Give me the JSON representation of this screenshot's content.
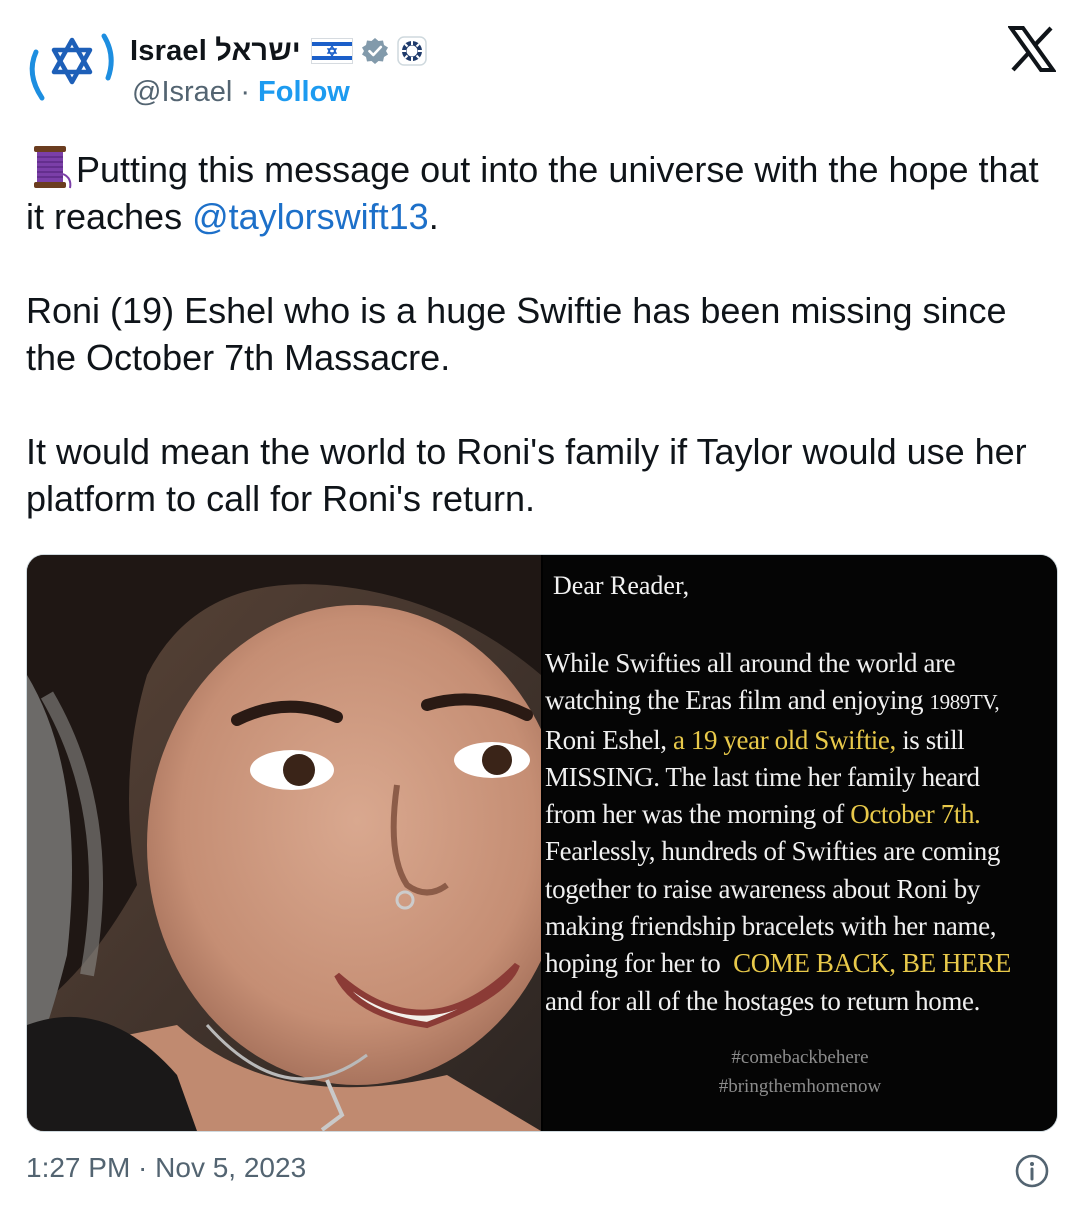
{
  "author": {
    "display_name": "Israel ישראל",
    "handle": "@Israel",
    "separator": "·",
    "follow_label": "Follow",
    "verified_color": "#829aab"
  },
  "icons": {
    "avatar": "star-of-david-logo",
    "flag": "israel-flag-emoji",
    "badge": "verified-gray-badge",
    "affiliation": "state-emblem-icon",
    "close": "x-logo",
    "spool": "thread-spool-emoji",
    "info": "info-circle-icon"
  },
  "tweet": {
    "line1_text": "Putting this message out into the universe with the hope that it reaches ",
    "mention": "@taylorswift13",
    "line1_end": ".",
    "para2": "Roni (19) Eshel who is a huge Swiftie has been missing since the October 7th Massacre.",
    "para3": "It would mean the world to Roni's family if Taylor would use her platform to call for Roni's return."
  },
  "media": {
    "letter": {
      "greeting": "Dear Reader,",
      "l1": "While Swifties all around the world are",
      "l2a": "watching the Eras film and enjoying ",
      "l2b": "1989TV,",
      "l3a": "Roni Eshel, ",
      "l3b": "a 19 year old Swiftie,",
      "l3c": " is still",
      "l4": "MISSING. The last time her family heard",
      "l5a": "from her was the morning of ",
      "l5b": "October 7th.",
      "l6": "Fearlessly, hundreds of Swifties are coming",
      "l7": "together to raise awareness about Roni by",
      "l8": "making friendship bracelets with her name,",
      "l9a": "hoping for her to  ",
      "l9b": "COME BACK, BE HERE",
      "l10": "and for all of the hostages to return home.",
      "hashtag1": "#comebackbehere",
      "hashtag2": "#bringthemhomenow"
    }
  },
  "footer": {
    "timestamp": "1:27 PM · Nov 5, 2023"
  },
  "colors": {
    "link": "#1d9bf0",
    "mention": "#1d70c9",
    "secondary_text": "#536471",
    "letter_highlight": "#e8c94a"
  }
}
